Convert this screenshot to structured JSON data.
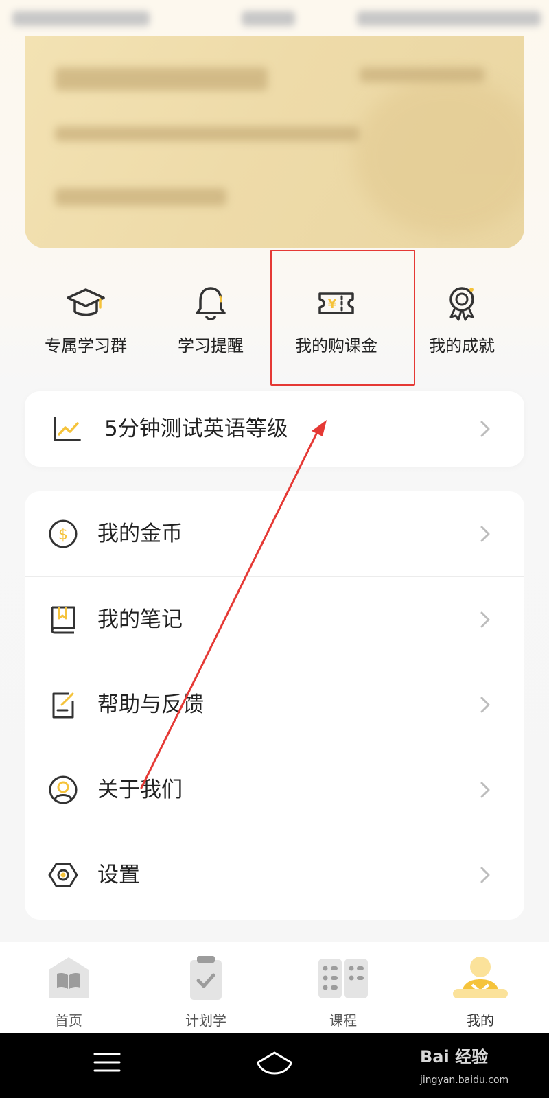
{
  "quick_actions": [
    {
      "label": "专属学习群",
      "icon": "graduation-cap-icon"
    },
    {
      "label": "学习提醒",
      "icon": "bell-icon"
    },
    {
      "label": "我的购课金",
      "icon": "yuan-ticket-icon"
    },
    {
      "label": "我的成就",
      "icon": "medal-icon"
    }
  ],
  "test_banner": {
    "label": "5分钟测试英语等级",
    "icon": "line-chart-icon"
  },
  "menu": [
    {
      "label": "我的金币",
      "icon": "coin-icon"
    },
    {
      "label": "我的笔记",
      "icon": "notebook-icon"
    },
    {
      "label": "帮助与反馈",
      "icon": "feedback-edit-icon"
    },
    {
      "label": "关于我们",
      "icon": "person-circle-icon"
    },
    {
      "label": "设置",
      "icon": "hexagon-settings-icon"
    }
  ],
  "bottom_nav": [
    {
      "label": "首页",
      "icon": "book-icon",
      "active": false
    },
    {
      "label": "计划学",
      "icon": "clipboard-check-icon",
      "active": false
    },
    {
      "label": "课程",
      "icon": "course-grid-icon",
      "active": false
    },
    {
      "label": "我的",
      "icon": "profile-icon",
      "active": true
    }
  ],
  "watermark": {
    "brand": "Bai 经验",
    "url": "jingyan.baidu.com"
  },
  "colors": {
    "accent": "#f5c33b",
    "annotation_red": "#e53935",
    "card_gold": "#eedba9",
    "icon_dark": "#333333"
  }
}
